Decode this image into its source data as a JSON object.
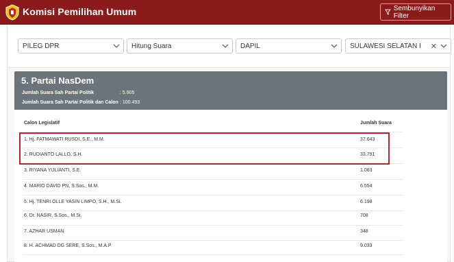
{
  "header": {
    "title": "Komisi Pemilihan Umum",
    "filter_button": "Sembunyikan Filter"
  },
  "filters": {
    "election": "PILEG DPR",
    "view": "Hitung Suara",
    "level": "DAPIL",
    "region": "SULAWESI SELATAN I"
  },
  "party": {
    "name": "5. Partai NasDem",
    "stats": [
      {
        "label": "Jumlah Suara Sah Partai Politik",
        "value": ":   5.905"
      },
      {
        "label": "Jumlah Suara Sah Partai Politik dan Calon",
        "value": ":   100.493"
      }
    ]
  },
  "table": {
    "col_name": "Calon Legislatif",
    "col_votes": "Jumlah Suara",
    "rows": [
      {
        "name": "1. Hj. FATMAWATI RUSDI, S.E., M.M.",
        "votes": "37.643"
      },
      {
        "name": "2. RUDIANTO LALLO, S.H.",
        "votes": "33.791"
      },
      {
        "name": "3. RIYANA YULIANTI, S.E.",
        "votes": "1.083"
      },
      {
        "name": "4. MARIO DAVID PN, S.Sos., M.M.",
        "votes": "6.554"
      },
      {
        "name": "5. Hj. TENRI OLLE YASIN LIMPO, S.H., M.Si.",
        "votes": "6.198"
      },
      {
        "name": "6. Dr. NASIR, S.Sos., M.Si.",
        "votes": "708"
      },
      {
        "name": "7. AZHAR USMAN",
        "votes": "348"
      },
      {
        "name": "8. H. ACHMAD DG SERE, S.Sos., M.A.P",
        "votes": "9.033"
      }
    ]
  },
  "colors": {
    "brand": "#8b1a1a",
    "party_header": "#6b747b",
    "highlight": "#c8202b"
  }
}
